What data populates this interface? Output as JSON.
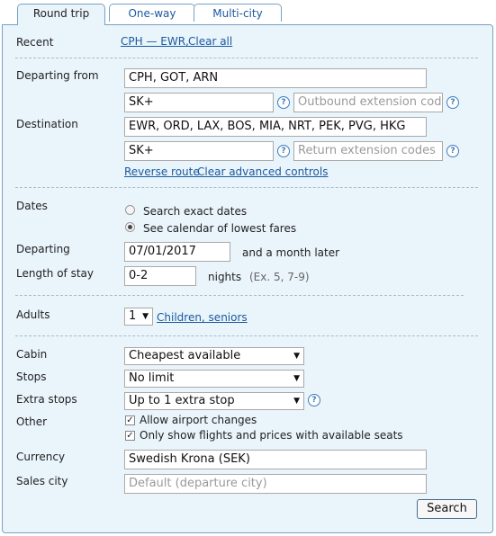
{
  "tabs": [
    {
      "label": "Round trip",
      "active": true
    },
    {
      "label": "One-way",
      "active": false
    },
    {
      "label": "Multi-city",
      "active": false
    }
  ],
  "recent": {
    "label": "Recent",
    "route": "CPH — EWR,",
    "clear": "Clear all"
  },
  "departing_from": {
    "label": "Departing from",
    "value": "CPH, GOT, ARN"
  },
  "outbound": {
    "code": "SK+",
    "extension_placeholder": "Outbound extension codes"
  },
  "destination": {
    "label": "Destination",
    "value": "EWR, ORD, LAX, BOS, MIA, NRT, PEK, PVG, HKG"
  },
  "return": {
    "code": "SK+",
    "extension_placeholder": "Return extension codes"
  },
  "route_links": {
    "reverse": "Reverse route",
    "clear_advanced": "Clear advanced controls"
  },
  "dates": {
    "label": "Dates",
    "option_exact": "Search exact dates",
    "option_calendar": "See calendar of lowest fares",
    "selected": "calendar"
  },
  "departing": {
    "label": "Departing",
    "value": "07/01/2017",
    "suffix": "and a month later"
  },
  "stay": {
    "label": "Length of stay",
    "value": "0-2",
    "unit": "nights",
    "example": "(Ex. 5, 7-9)"
  },
  "adults": {
    "label": "Adults",
    "value": "1",
    "link": "Children, seniors"
  },
  "cabin": {
    "label": "Cabin",
    "value": "Cheapest available"
  },
  "stops": {
    "label": "Stops",
    "value": "No limit"
  },
  "extra_stops": {
    "label": "Extra stops",
    "value": "Up to 1 extra stop"
  },
  "other": {
    "label": "Other",
    "allow_airport_changes": "Allow airport changes",
    "available_seats": "Only show flights and prices with available seats"
  },
  "currency": {
    "label": "Currency",
    "value": "Swedish Krona (SEK)"
  },
  "sales_city": {
    "label": "Sales city",
    "placeholder": "Default (departure city)"
  },
  "search_button": "Search",
  "icons": {
    "help": "help-icon",
    "dropdown": "chevron-down-icon"
  },
  "colors": {
    "panel_bg": "#eaf4fb",
    "link": "#1a5aa0",
    "border": "#7aa0c4"
  }
}
